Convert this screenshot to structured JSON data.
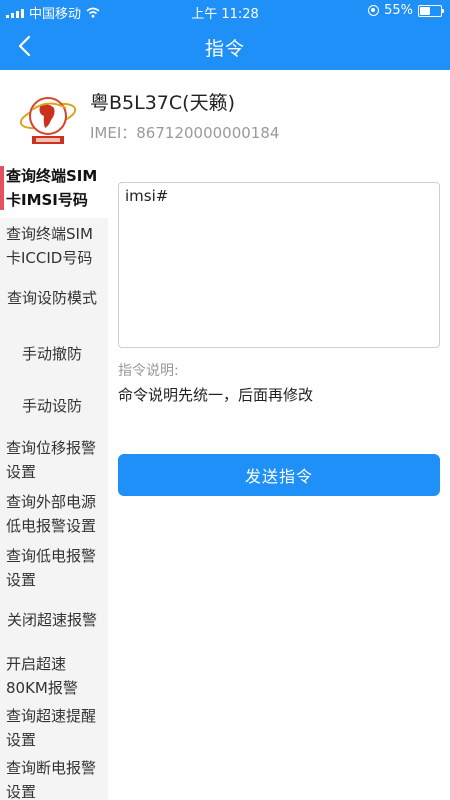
{
  "status_bar": {
    "carrier": "中国移动",
    "time": "上午 11:28",
    "battery": "55%",
    "battery_level": 0.55
  },
  "nav": {
    "title": "指令",
    "back_icon": "chevron-left-icon"
  },
  "vehicle": {
    "name": "粤B5L37C(天籁)",
    "imei": "IMEI：867120000000184"
  },
  "sidebar": {
    "items": [
      {
        "label": "查询终端SIM卡IMSI号码",
        "active": true
      },
      {
        "label": "查询终端SIM卡ICCID号码",
        "active": false
      },
      {
        "label": "查询设防模式",
        "active": false
      },
      {
        "label": "手动撤防",
        "active": false
      },
      {
        "label": "手动设防",
        "active": false
      },
      {
        "label": "查询位移报警设置",
        "active": false
      },
      {
        "label": "查询外部电源低电报警设置",
        "active": false
      },
      {
        "label": "查询低电报警设置",
        "active": false
      },
      {
        "label": "关闭超速报警",
        "active": false
      },
      {
        "label": "开启超速80KM报警",
        "active": false
      },
      {
        "label": "查询超速提醒设置",
        "active": false
      },
      {
        "label": "查询断电报警设置",
        "active": false
      }
    ]
  },
  "command": {
    "value": "imsi#",
    "description_label": "指令说明:",
    "description": "命令说明先统一，后面再修改",
    "send_label": "发送指令"
  },
  "colors": {
    "primary": "#1e90f7",
    "active_indicator": "#e5505e",
    "sidebar_bg": "#f4f4f4"
  }
}
